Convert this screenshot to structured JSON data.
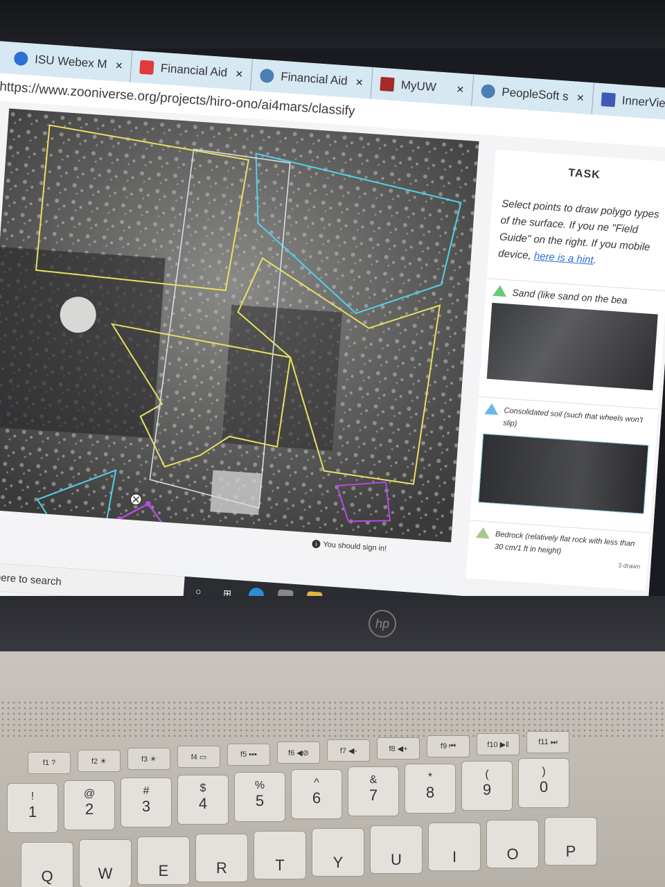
{
  "browser": {
    "tabs": [
      {
        "label": "ISU Webex M",
        "icon": "webex-icon",
        "color": "#2e6fd6"
      },
      {
        "label": "Financial Aid",
        "icon": "adobe-icon",
        "color": "#e03a3a"
      },
      {
        "label": "Financial Aid",
        "icon": "globe-icon",
        "color": "#4a7fb3"
      },
      {
        "label": "MyUW",
        "icon": "w-logo-icon",
        "color": "#a52a2a"
      },
      {
        "label": "PeopleSoft s",
        "icon": "globe-icon",
        "color": "#4a7fb3"
      },
      {
        "label": "InnerView",
        "icon": "innerview-icon",
        "color": "#3b5bb8"
      }
    ],
    "close_glyph": "×",
    "url": "https://www.zooniverse.org/projects/hiro-ono/ai4mars/classify"
  },
  "task": {
    "heading": "TASK",
    "instructions": "Select points to draw polygo types of the surface. If you ne \"Field Guide\" on the right. If you mobile device,",
    "hint_link": "here is a hint",
    "hint_suffix": "."
  },
  "options": [
    {
      "label": "Sand (like sand on the bea",
      "color": "#66cc77"
    },
    {
      "label": "Consolidated soil (such that wheels won't slip)",
      "color": "#6ab8e6"
    },
    {
      "label": "Bedrock (relatively flat rock with less than 30 cm/1 ft in height)",
      "count": "3",
      "count_label": "drawn",
      "color": "#a8c88a"
    }
  ],
  "subject": {
    "sign_in_notice": "You should sign in!",
    "info_glyph": "i"
  },
  "taskbar": {
    "search_placeholder": "Type here to search"
  },
  "laptop": {
    "brand": "hp",
    "function_keys": [
      "f1 ?",
      "f2 ☀",
      "f3 ☀",
      "f4 ▭",
      "f5 ▪▪▪",
      "f6 ◀⊘",
      "f7 ◀-",
      "f8 ◀+",
      "f9 ⏮",
      "f10 ▶‖",
      "f11 ⏭"
    ],
    "number_keys": [
      {
        "top": "!",
        "main": "1"
      },
      {
        "top": "@",
        "main": "2"
      },
      {
        "top": "#",
        "main": "3"
      },
      {
        "top": "$",
        "main": "4"
      },
      {
        "top": "%",
        "main": "5"
      },
      {
        "top": "^",
        "main": "6"
      },
      {
        "top": "&",
        "main": "7"
      },
      {
        "top": "*",
        "main": "8"
      },
      {
        "top": "(",
        "main": "9"
      },
      {
        "top": ")",
        "main": "0"
      }
    ],
    "letter_keys": [
      "Q",
      "W",
      "E",
      "R",
      "T",
      "Y",
      "U",
      "I",
      "O",
      "P"
    ]
  },
  "colors": {
    "polygon_yellow": "#e8e060",
    "polygon_cyan": "#4fd2e8",
    "polygon_purple": "#b44ce0",
    "polygon_white": "#d8dde2"
  }
}
